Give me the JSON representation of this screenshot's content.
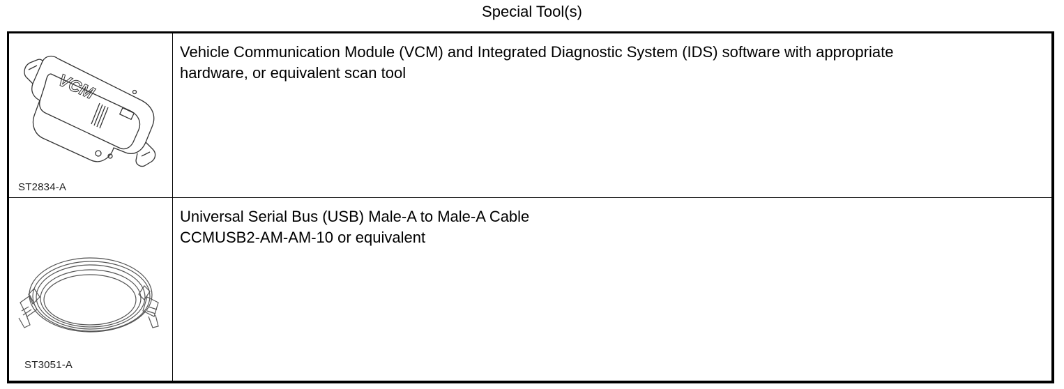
{
  "title": "Special Tool(s)",
  "tools": [
    {
      "tool_number": "ST2834-A",
      "description_lines": [
        "Vehicle Communication Module (VCM) and Integrated Diagnostic System (IDS) software with appropriate",
        "hardware, or equivalent scan tool"
      ],
      "illustration_text": "VCM"
    },
    {
      "tool_number": "ST3051-A",
      "description_lines": [
        "Universal Serial Bus (USB) Male-A to Male-A Cable",
        "CCMUSB2-AM-AM-10 or equivalent"
      ]
    }
  ]
}
